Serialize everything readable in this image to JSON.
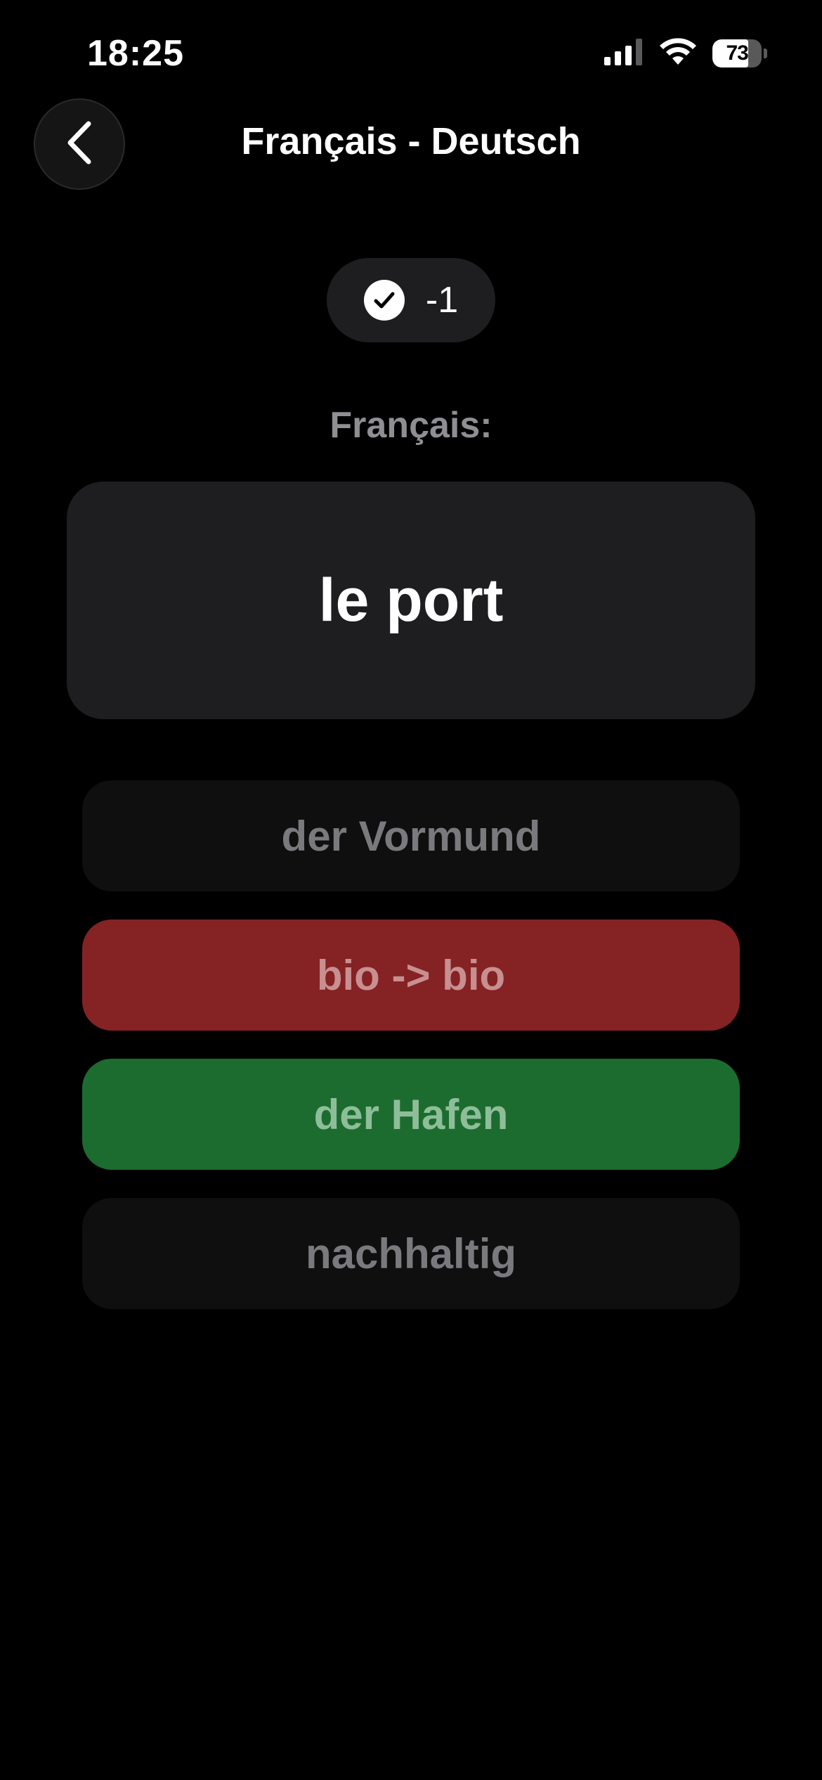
{
  "status_bar": {
    "time": "18:25",
    "battery_level": "73",
    "battery_fraction": 0.73,
    "icons": [
      "cellular-signal-icon",
      "wifi-icon",
      "battery-icon"
    ]
  },
  "header": {
    "title": "Français - Deutsch",
    "back_icon": "chevron-left-icon"
  },
  "score": {
    "icon": "checkmark-circle-icon",
    "value": "-1"
  },
  "question": {
    "source_language_label": "Français:",
    "word": "le port"
  },
  "options": [
    {
      "label": "der Vormund",
      "state": "neutral"
    },
    {
      "label": "bio -> bio",
      "state": "wrong"
    },
    {
      "label": "der Hafen",
      "state": "correct"
    },
    {
      "label": "nachhaltig",
      "state": "neutral"
    }
  ],
  "colors": {
    "background": "#000000",
    "card": "#1e1e20",
    "wrong": "#852224",
    "correct": "#1c6c2f",
    "muted_text": "#8e8e93"
  }
}
